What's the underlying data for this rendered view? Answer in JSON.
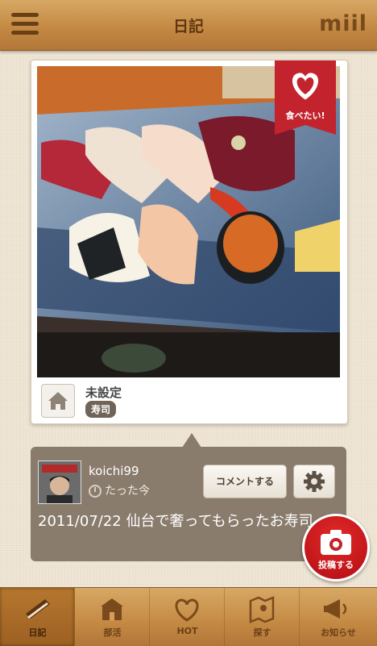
{
  "header": {
    "title": "日記",
    "brand": "miil"
  },
  "post": {
    "want_to_eat_label": "食べたい!",
    "place_name": "未設定",
    "tag": "寿司",
    "username": "koichi99",
    "time": "たった今",
    "comment_button_label": "コメントする",
    "text": "2011/07/22 仙台で奢ってもらったお寿司。"
  },
  "post_button_label": "投稿する",
  "nav": {
    "items": [
      {
        "label": "日記",
        "icon": "diary-icon"
      },
      {
        "label": "部活",
        "icon": "club-icon"
      },
      {
        "label": "HOT",
        "icon": "hot-heart-icon"
      },
      {
        "label": "探す",
        "icon": "map-pin-icon"
      },
      {
        "label": "お知らせ",
        "icon": "megaphone-icon"
      }
    ],
    "active_index": 0
  },
  "colors": {
    "header_brown": "#c48a44",
    "accent_red": "#c2232c",
    "bubble": "#8a7c6d"
  }
}
